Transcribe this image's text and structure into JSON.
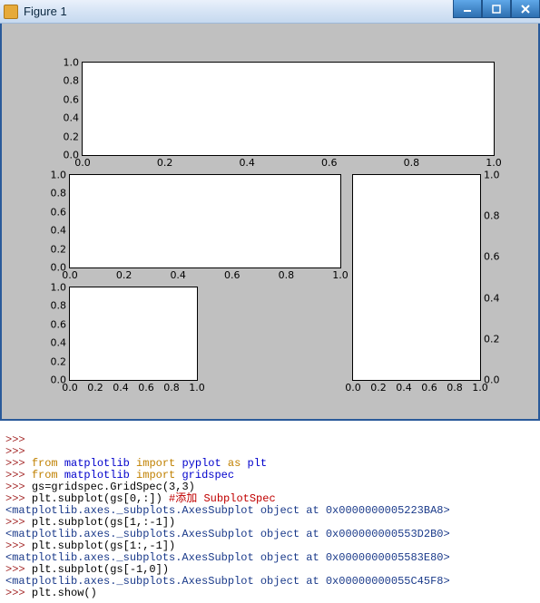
{
  "window": {
    "title": "Figure 1",
    "controls": {
      "min": "minimize",
      "max": "maximize",
      "close": "close"
    }
  },
  "chart_data": [
    {
      "type": "line",
      "id": "ax1",
      "title": "",
      "xlabel": "",
      "ylabel": "",
      "xlim": [
        0.0,
        1.0
      ],
      "ylim": [
        0.0,
        1.0
      ],
      "xticks": [
        0.0,
        0.2,
        0.4,
        0.6,
        0.8,
        1.0
      ],
      "yticks": [
        0.0,
        0.2,
        0.4,
        0.6,
        0.8,
        1.0
      ],
      "series": [],
      "y_axis_side": "left",
      "gridspec": "gs[0,:]"
    },
    {
      "type": "line",
      "id": "ax2",
      "title": "",
      "xlabel": "",
      "ylabel": "",
      "xlim": [
        0.0,
        1.0
      ],
      "ylim": [
        0.0,
        1.0
      ],
      "xticks": [
        0.0,
        0.2,
        0.4,
        0.6,
        0.8,
        1.0
      ],
      "yticks": [
        0.0,
        0.2,
        0.4,
        0.6,
        0.8,
        1.0
      ],
      "series": [],
      "y_axis_side": "left",
      "gridspec": "gs[1,:-1]"
    },
    {
      "type": "line",
      "id": "ax3",
      "title": "",
      "xlabel": "",
      "ylabel": "",
      "xlim": [
        0.0,
        1.0
      ],
      "ylim": [
        0.0,
        1.0
      ],
      "xticks": [
        0.0,
        0.2,
        0.4,
        0.6,
        0.8,
        1.0
      ],
      "yticks": [
        0.0,
        0.2,
        0.4,
        0.6,
        0.8,
        1.0
      ],
      "series": [],
      "y_axis_side": "right",
      "gridspec": "gs[1:,-1]"
    },
    {
      "type": "line",
      "id": "ax4",
      "title": "",
      "xlabel": "",
      "ylabel": "",
      "xlim": [
        0.0,
        1.0
      ],
      "ylim": [
        0.0,
        1.0
      ],
      "xticks": [
        0.0,
        0.2,
        0.4,
        0.6,
        0.8,
        1.0
      ],
      "yticks": [
        0.0,
        0.2,
        0.4,
        0.6,
        0.8,
        1.0
      ],
      "series": [],
      "y_axis_side": "left",
      "gridspec": "gs[-1,0]"
    }
  ],
  "ticks6": [
    "0.0",
    "0.2",
    "0.4",
    "0.6",
    "0.8",
    "1.0"
  ],
  "console": {
    "p": ">>>",
    "l1a": "from",
    "l1b": "matplotlib",
    "l1c": "import",
    "l1d": "pyplot",
    "l1e": "as",
    "l1f": "plt",
    "l2a": "from",
    "l2b": "matplotlib",
    "l2c": "import",
    "l2d": "gridspec",
    "l3": "gs=gridspec.GridSpec(3,3)",
    "l4": "plt.subplot(gs[0,:])",
    "l4c": "#添加 SubplotSpec",
    "o1": "<matplotlib.axes._subplots.AxesSubplot object at 0x0000000005223BA8>",
    "l5": "plt.subplot(gs[1,:-1])",
    "o2": "<matplotlib.axes._subplots.AxesSubplot object at 0x000000000553D2B0>",
    "l6": "plt.subplot(gs[1:,-1])",
    "o3": "<matplotlib.axes._subplots.AxesSubplot object at 0x0000000005583E80>",
    "l7": "plt.subplot(gs[-1,0])",
    "o4": "<matplotlib.axes._subplots.AxesSubplot object at 0x00000000055C45F8>",
    "l8": "plt.show()"
  }
}
